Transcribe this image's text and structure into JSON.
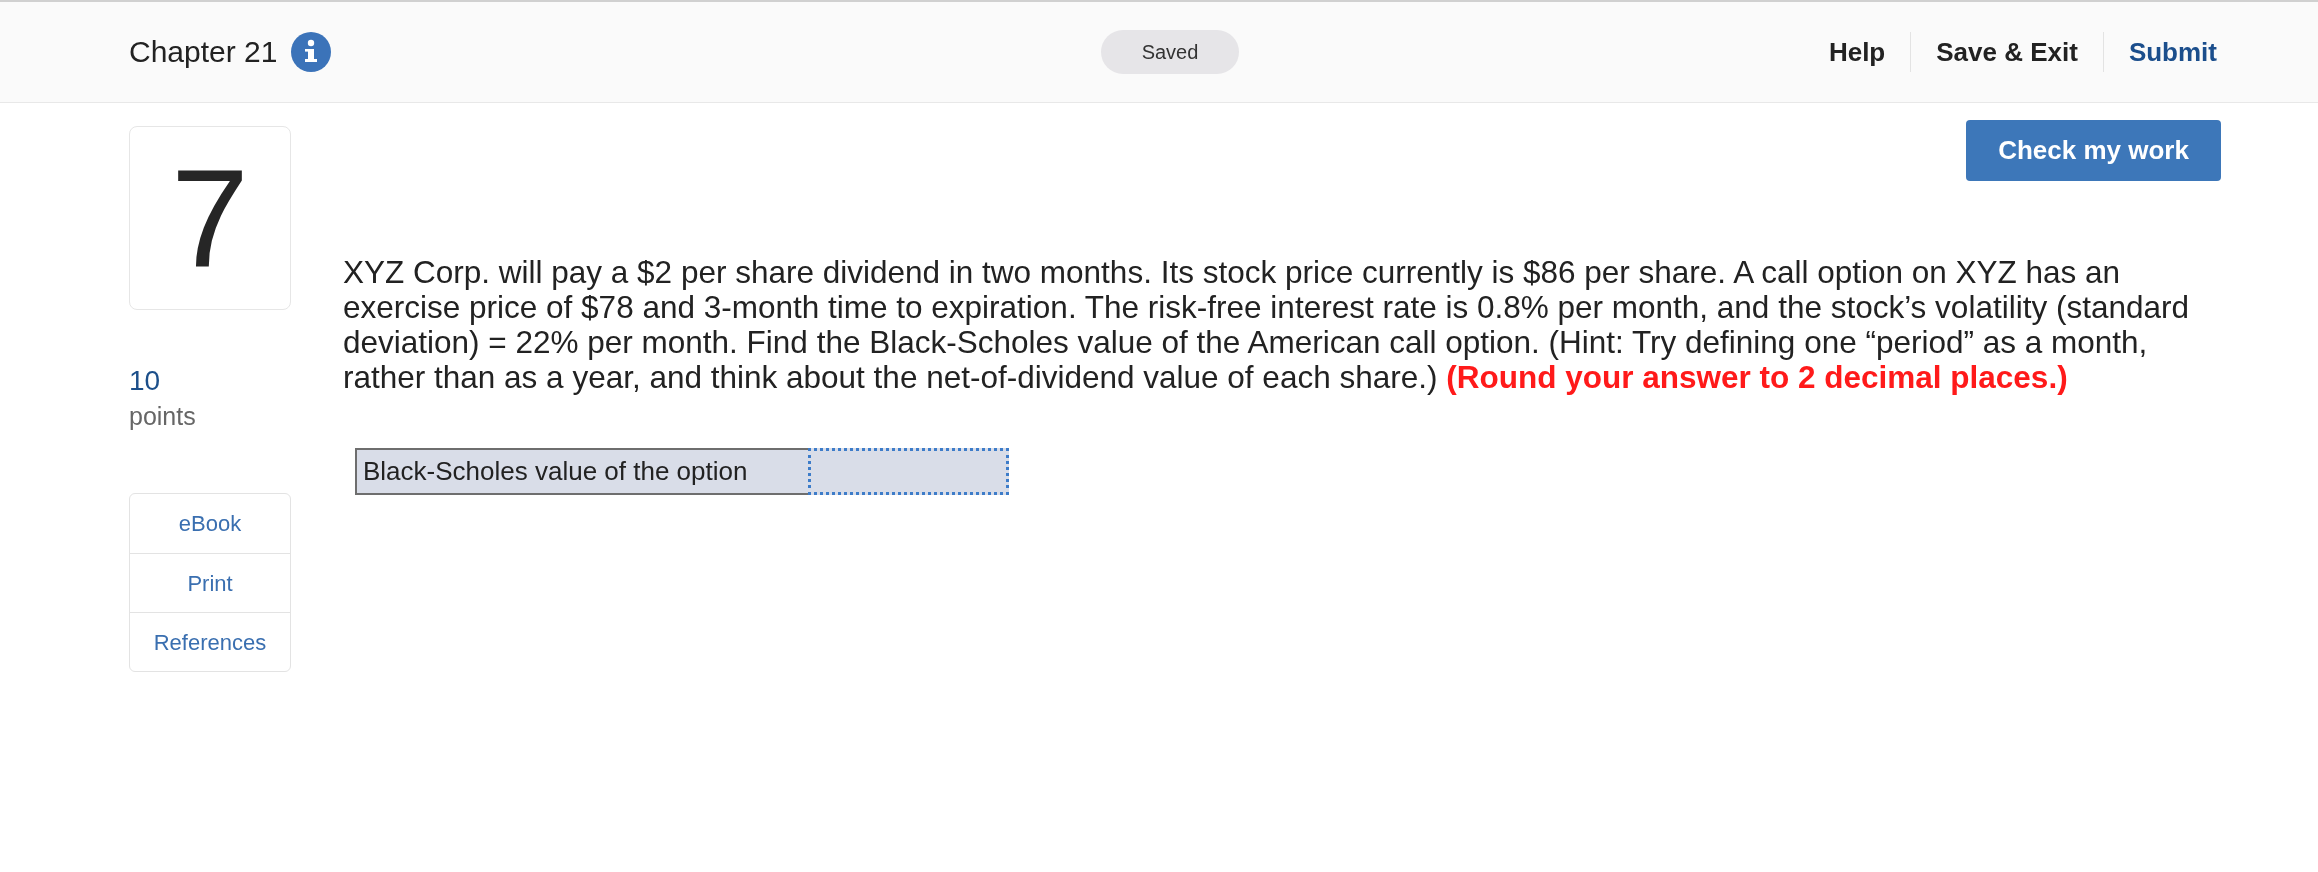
{
  "header": {
    "title": "Chapter 21",
    "status": "Saved",
    "nav": [
      {
        "label": "Help",
        "kind": "plain"
      },
      {
        "label": "Save & Exit",
        "kind": "plain"
      },
      {
        "label": "Submit",
        "kind": "primary"
      }
    ]
  },
  "question": {
    "number": "7",
    "points": "10",
    "points_label": "points"
  },
  "tools": [
    "eBook",
    "Print",
    "References"
  ],
  "check_button": "Check my work",
  "prompt": "XYZ Corp. will pay a $2 per share dividend in two months. Its stock price currently is $86 per share. A call option on XYZ has an exercise price of $78 and 3-month time to expiration. The risk-free interest rate is 0.8% per month, and the stock’s volatility (standard deviation) = 22% per month. Find the Black-Scholes value of the American call option. (Hint: Try defining one “period” as a month, rather than as a year, and think about the net-of-dividend value of each share.) **(Round your answer to 2 decimal places.)**",
  "answer_table": {
    "rows": [
      {
        "label": "Black-Scholes value of the option",
        "focused": true
      }
    ]
  }
}
